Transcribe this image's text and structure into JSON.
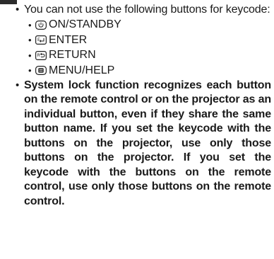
{
  "notes": {
    "bullet": "•",
    "first_note": {
      "text": "You can not use the following buttons for keycode:",
      "buttons": [
        {
          "icon": "power-button-icon",
          "label": "ON/STANDBY"
        },
        {
          "icon": "enter-button-icon",
          "label": "ENTER"
        },
        {
          "icon": "return-button-icon",
          "label": "RETURN"
        },
        {
          "icon": "menu-button-icon",
          "label": "MENU/HELP"
        }
      ]
    },
    "second_note": {
      "text": "System lock function recognizes each button on the remote control or on the projector as an individual button, even if they share the same button name. If you set the keycode with the buttons on the projector, use only those buttons on the projector. If you set the keycode with the buttons on the remote control, use only those buttons on the remote control."
    }
  }
}
